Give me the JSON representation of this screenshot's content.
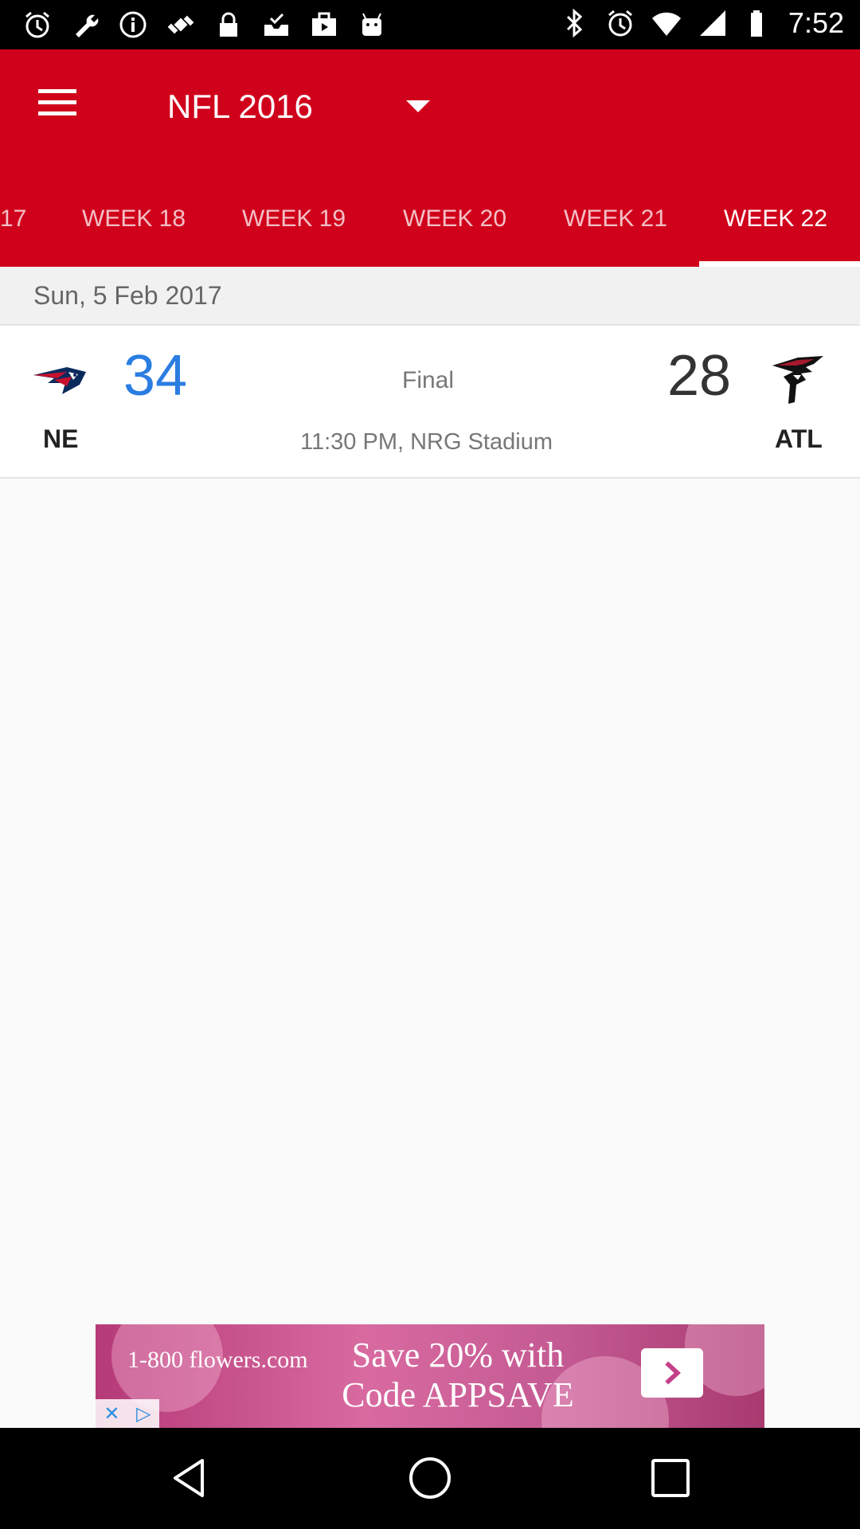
{
  "status_bar": {
    "time": "7:52",
    "left_icons": [
      "alarm-icon",
      "wrench-icon",
      "info-icon",
      "fake-gps-icon",
      "lock-icon",
      "inbox-check-icon",
      "briefcase-icon",
      "android-icon"
    ],
    "right_icons": [
      "bluetooth-icon",
      "alarm-icon",
      "wifi-icon",
      "signal-icon",
      "battery-icon"
    ]
  },
  "app_bar": {
    "title": "NFL 2016",
    "color": "#d0021b"
  },
  "tabs": [
    {
      "label": "17"
    },
    {
      "label": "WEEK 18"
    },
    {
      "label": "WEEK 19"
    },
    {
      "label": "WEEK 20"
    },
    {
      "label": "WEEK 21"
    },
    {
      "label": "WEEK 22",
      "active": true
    }
  ],
  "date_header": "Sun, 5 Feb 2017",
  "game": {
    "home_team": "NE",
    "home_score": "34",
    "away_team": "ATL",
    "away_score": "28",
    "status": "Final",
    "time_venue": "11:30 PM, NRG Stadium",
    "home_logo_icon": "patriots-logo-icon",
    "away_logo_icon": "falcons-logo-icon"
  },
  "ad": {
    "brand": "1-800 flowers.com",
    "headline_line1": "Save 20% with",
    "headline_line2": "Code APPSAVE"
  },
  "nav_bar": {
    "icons": [
      "back-icon",
      "home-icon",
      "recents-icon"
    ]
  }
}
